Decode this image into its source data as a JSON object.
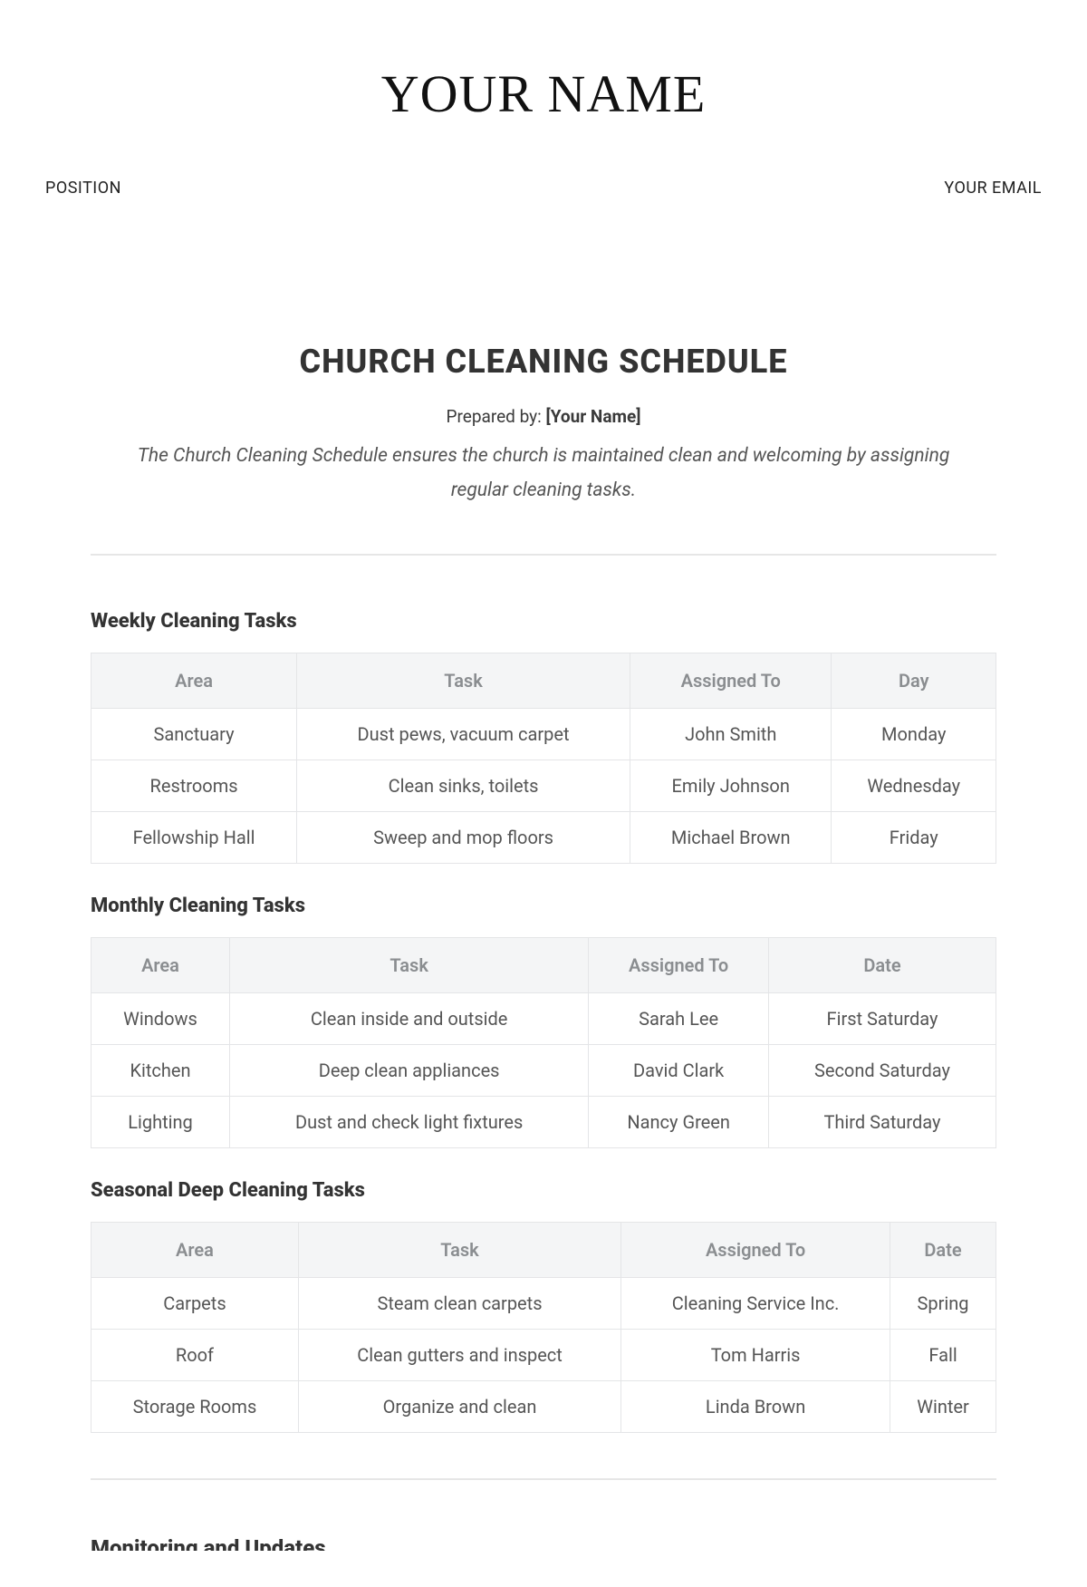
{
  "header": {
    "name": "YOUR NAME",
    "position": "POSITION",
    "email": "YOUR EMAIL"
  },
  "doc": {
    "title": "CHURCH CLEANING SCHEDULE",
    "prepared_label": "Prepared by: ",
    "prepared_value": "[Your Name]",
    "description": "The Church Cleaning Schedule ensures the church is maintained clean and welcoming by assigning regular cleaning tasks."
  },
  "sections": {
    "weekly": {
      "title": "Weekly Cleaning Tasks",
      "headers": [
        "Area",
        "Task",
        "Assigned To",
        "Day"
      ],
      "rows": [
        [
          "Sanctuary",
          "Dust pews, vacuum carpet",
          "John Smith",
          "Monday"
        ],
        [
          "Restrooms",
          "Clean sinks, toilets",
          "Emily Johnson",
          "Wednesday"
        ],
        [
          "Fellowship Hall",
          "Sweep and mop floors",
          "Michael Brown",
          "Friday"
        ]
      ]
    },
    "monthly": {
      "title": "Monthly Cleaning Tasks",
      "headers": [
        "Area",
        "Task",
        "Assigned To",
        "Date"
      ],
      "rows": [
        [
          "Windows",
          "Clean inside and outside",
          "Sarah Lee",
          "First Saturday"
        ],
        [
          "Kitchen",
          "Deep clean appliances",
          "David Clark",
          "Second Saturday"
        ],
        [
          "Lighting",
          "Dust and check light fixtures",
          "Nancy Green",
          "Third Saturday"
        ]
      ]
    },
    "seasonal": {
      "title": "Seasonal Deep Cleaning Tasks",
      "headers": [
        "Area",
        "Task",
        "Assigned To",
        "Date"
      ],
      "rows": [
        [
          "Carpets",
          "Steam clean carpets",
          "Cleaning Service Inc.",
          "Spring"
        ],
        [
          "Roof",
          "Clean gutters and inspect",
          "Tom Harris",
          "Fall"
        ],
        [
          "Storage Rooms",
          "Organize and clean",
          "Linda Brown",
          "Winter"
        ]
      ]
    }
  },
  "cutoff_heading": "Monitoring and Updates"
}
